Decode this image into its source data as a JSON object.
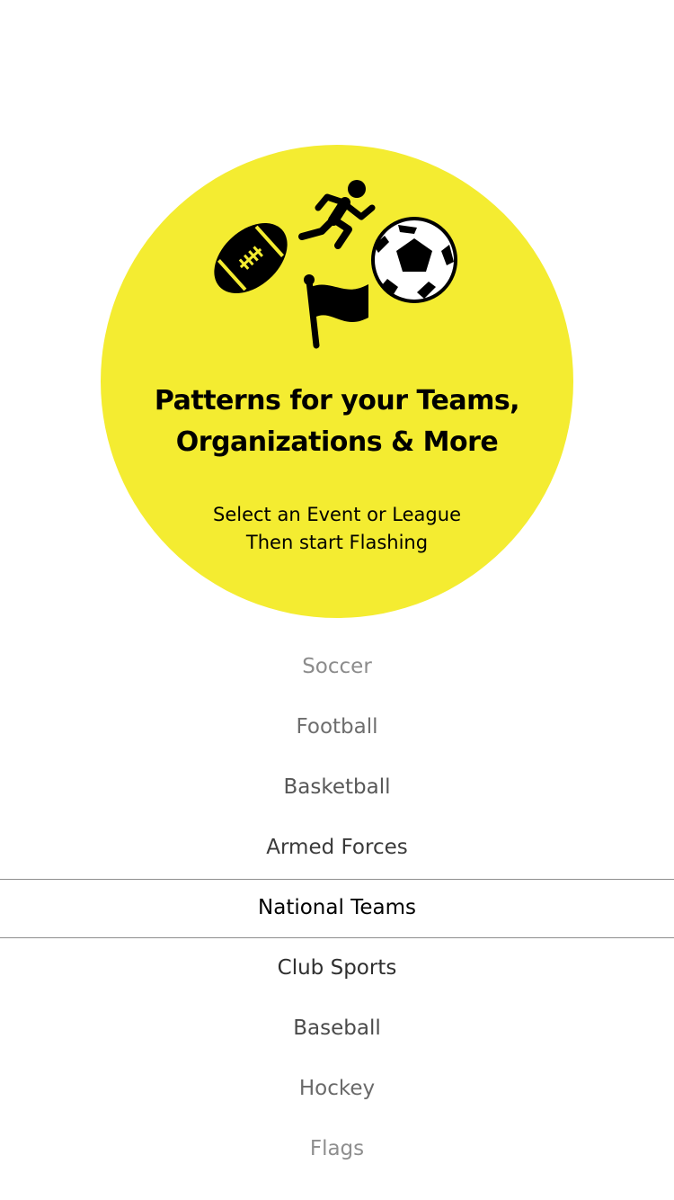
{
  "hero": {
    "title_line1": "Patterns for your Teams,",
    "title_line2": "Organizations & More",
    "subtitle_line1": "Select an Event or League",
    "subtitle_line2": "Then start Flashing",
    "icons": [
      "american-football-icon",
      "runner-icon",
      "soccer-ball-icon",
      "flag-icon"
    ],
    "circle_color": "#f4ec31"
  },
  "picker": {
    "selected_index": 4,
    "items": [
      {
        "label": "Soccer"
      },
      {
        "label": "Football"
      },
      {
        "label": "Basketball"
      },
      {
        "label": "Armed Forces"
      },
      {
        "label": "National Teams"
      },
      {
        "label": "Club Sports"
      },
      {
        "label": "Baseball"
      },
      {
        "label": "Hockey"
      },
      {
        "label": "Flags"
      }
    ]
  }
}
